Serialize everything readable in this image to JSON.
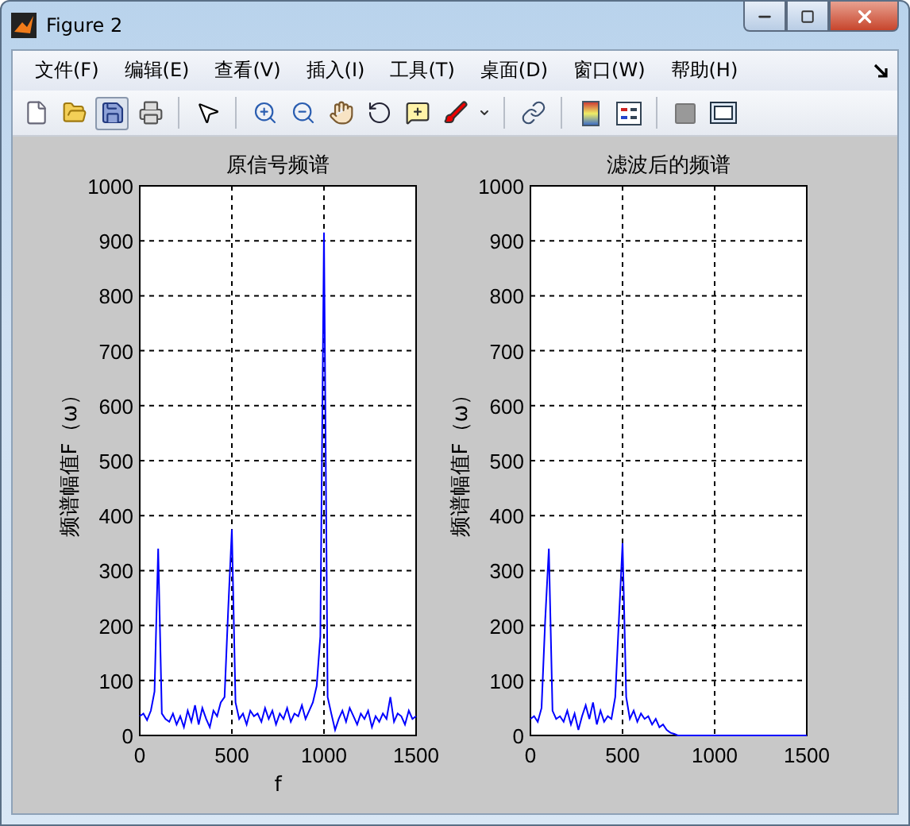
{
  "window": {
    "title": "Figure 2"
  },
  "menu": [
    "文件(F)",
    "编辑(E)",
    "查看(V)",
    "插入(I)",
    "工具(T)",
    "桌面(D)",
    "窗口(W)",
    "帮助(H)"
  ],
  "plots": [
    {
      "chart_data": {
        "type": "line",
        "title": "原信号频谱",
        "xlabel": "f",
        "ylabel": "频谱幅值F（ω）",
        "grid": true,
        "xlim": [
          0,
          1500
        ],
        "ylim": [
          0,
          1000
        ],
        "xticks": [
          0,
          500,
          1000,
          1500
        ],
        "yticks": [
          0,
          100,
          200,
          300,
          400,
          500,
          600,
          700,
          800,
          900,
          1000
        ],
        "x": [
          0,
          20,
          40,
          60,
          80,
          100,
          120,
          140,
          160,
          180,
          200,
          220,
          240,
          260,
          280,
          300,
          320,
          340,
          360,
          380,
          400,
          420,
          440,
          460,
          480,
          500,
          520,
          540,
          560,
          580,
          600,
          620,
          640,
          660,
          680,
          700,
          720,
          740,
          760,
          780,
          800,
          820,
          840,
          860,
          880,
          900,
          920,
          940,
          960,
          980,
          1000,
          1020,
          1040,
          1060,
          1080,
          1100,
          1120,
          1140,
          1160,
          1180,
          1200,
          1220,
          1240,
          1260,
          1280,
          1300,
          1320,
          1340,
          1360,
          1380,
          1400,
          1420,
          1440,
          1460,
          1480,
          1500
        ],
        "series": [
          {
            "color": "#0000ff",
            "values": [
              35,
              40,
              28,
              45,
              80,
              340,
              40,
              30,
              25,
              40,
              20,
              35,
              15,
              45,
              25,
              55,
              20,
              50,
              30,
              15,
              45,
              35,
              60,
              70,
              230,
              375,
              60,
              30,
              40,
              20,
              45,
              35,
              40,
              25,
              50,
              30,
              45,
              20,
              40,
              30,
              50,
              25,
              40,
              35,
              55,
              30,
              45,
              60,
              90,
              180,
              915,
              70,
              40,
              10,
              30,
              45,
              25,
              50,
              35,
              20,
              40,
              30,
              45,
              15,
              35,
              25,
              40,
              30,
              70,
              25,
              40,
              35,
              20,
              45,
              30,
              35
            ]
          }
        ]
      }
    },
    {
      "chart_data": {
        "type": "line",
        "title": "滤波后的频谱",
        "ylabel": "频谱幅值F（ω）",
        "grid": true,
        "xlim": [
          0,
          1500
        ],
        "ylim": [
          0,
          1000
        ],
        "xticks": [
          0,
          500,
          1000,
          1500
        ],
        "yticks": [
          0,
          100,
          200,
          300,
          400,
          500,
          600,
          700,
          800,
          900,
          1000
        ],
        "x": [
          0,
          20,
          40,
          60,
          80,
          100,
          120,
          140,
          160,
          180,
          200,
          220,
          240,
          260,
          280,
          300,
          320,
          340,
          360,
          380,
          400,
          420,
          440,
          460,
          480,
          500,
          520,
          540,
          560,
          580,
          600,
          620,
          640,
          660,
          680,
          700,
          720,
          740,
          760,
          780,
          800,
          820,
          840,
          860,
          880,
          900,
          920,
          940,
          960,
          980,
          1000,
          1020,
          1040,
          1060,
          1080,
          1100,
          1120,
          1140,
          1160,
          1180,
          1200,
          1220,
          1240,
          1260,
          1280,
          1300,
          1320,
          1340,
          1360,
          1380,
          1400,
          1420,
          1440,
          1460,
          1480,
          1500
        ],
        "series": [
          {
            "color": "#0000ff",
            "values": [
              30,
              35,
              25,
              50,
              210,
              340,
              45,
              30,
              35,
              25,
              45,
              20,
              40,
              10,
              35,
              55,
              30,
              60,
              20,
              45,
              25,
              35,
              30,
              70,
              210,
              350,
              70,
              30,
              45,
              25,
              40,
              30,
              35,
              20,
              30,
              15,
              20,
              10,
              5,
              3,
              0,
              0,
              0,
              0,
              0,
              0,
              0,
              0,
              0,
              0,
              0,
              0,
              0,
              0,
              0,
              0,
              0,
              0,
              0,
              0,
              0,
              0,
              0,
              0,
              0,
              0,
              0,
              0,
              0,
              0,
              0,
              0,
              0,
              0,
              0,
              0
            ]
          }
        ]
      }
    }
  ]
}
